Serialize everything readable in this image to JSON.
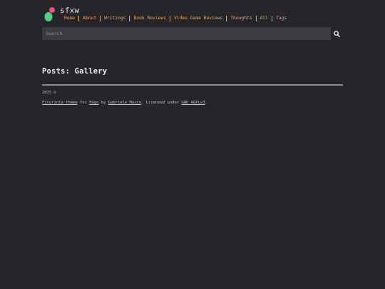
{
  "header": {
    "site_title": "sfxw",
    "nav": [
      {
        "label": "Home"
      },
      {
        "label": "About"
      },
      {
        "label": "Writings"
      },
      {
        "label": "Book Reviews"
      },
      {
        "label": "Video Game Reviews"
      },
      {
        "label": "Thoughts"
      },
      {
        "label": "All"
      },
      {
        "label": "Tags"
      }
    ]
  },
  "search": {
    "placeholder": "Search",
    "icon": "search-icon"
  },
  "main": {
    "page_title": "Posts: Gallery"
  },
  "footer": {
    "copyright": "2025 ©",
    "theme_link": "Ficurinia theme",
    "for_text": "for",
    "hugo_link": "Hugo",
    "by_text": "by",
    "author_link": "Gabriele Musco",
    "licensed_text": ". Licensed under",
    "license_link": "GNU AGPLv3",
    "end_text": "."
  },
  "colors": {
    "background": "#252629",
    "accent": "#f2a164",
    "logo_pink": "#e8507e",
    "logo_green": "#4fd17f"
  }
}
